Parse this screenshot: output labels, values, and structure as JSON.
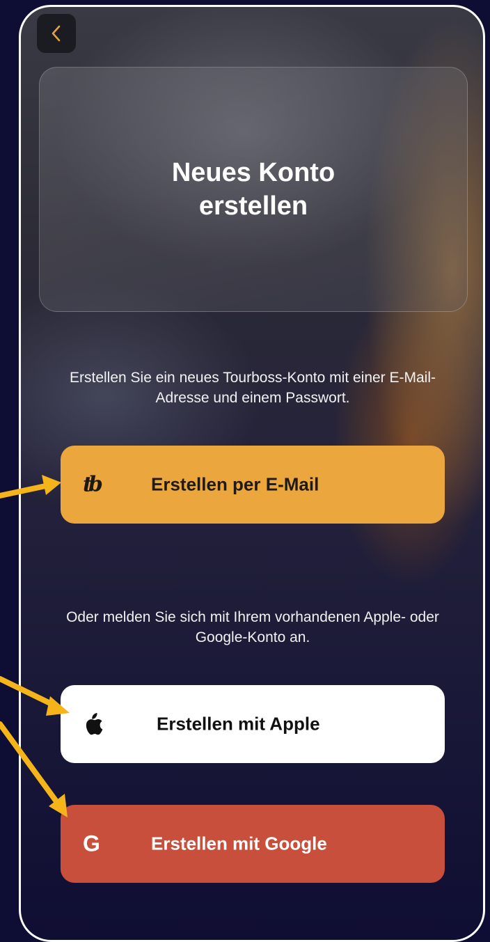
{
  "header": {
    "back_icon": "chevron-left-icon"
  },
  "hero": {
    "title": "Neues Konto erstellen"
  },
  "description": {
    "primary": "Erstellen Sie ein neues Tourboss-Konto mit einer E-Mail-Adresse und einem Passwort.",
    "secondary": "Oder melden Sie sich mit Ihrem vorhandenen Apple- oder Google-Konto an."
  },
  "buttons": {
    "email": {
      "label": "Erstellen per E-Mail",
      "icon": "tourboss-logo-icon",
      "logo_text": "tb",
      "color": "#eba63d"
    },
    "apple": {
      "label": "Erstellen mit Apple",
      "icon": "apple-icon",
      "color": "#ffffff"
    },
    "google": {
      "label": "Erstellen mit Google",
      "icon": "google-icon",
      "logo_text": "G",
      "color": "#c94f3d"
    }
  },
  "annotations": {
    "arrow_color": "#f5b51a"
  }
}
